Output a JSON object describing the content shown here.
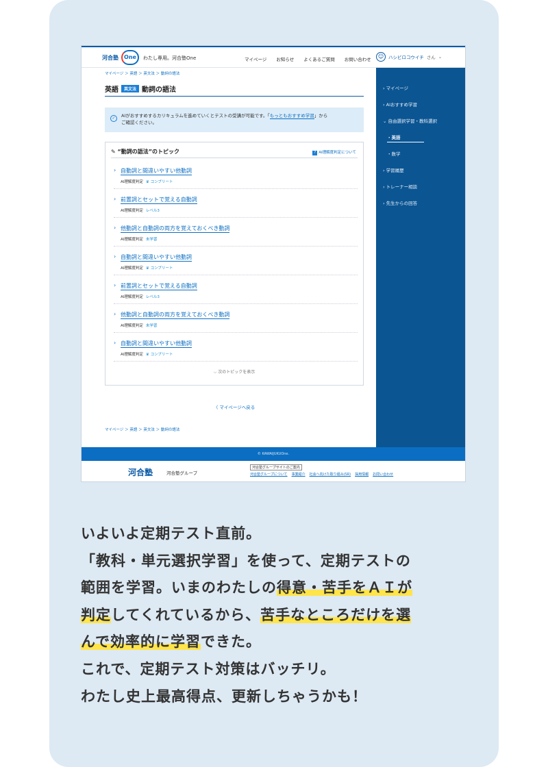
{
  "header": {
    "logo_text": "河合塾",
    "logo_one": "One",
    "logo_sub": "わたし専用。河合塾One",
    "nav": [
      "マイページ",
      "お知らせ",
      "よくあるご質問",
      "お問い合わせ"
    ],
    "user_name": "ハシビロコウイチ",
    "user_suffix": "さん",
    "caret": "⌄"
  },
  "breadcrumb": "マイページ ＞ 英語 ＞ 英文法 ＞ 動詞の語法",
  "page": {
    "subject": "英語",
    "badge": "英文法",
    "title": "動詞の語法"
  },
  "notice": {
    "text1": "AIがおすすめするカリキュラムを進めていくとテストの受講が可能です。「",
    "link": "もっともおすすめ学習",
    "text2": "」から",
    "text3": "ご確認ください。"
  },
  "topics": {
    "title": "“動詞の語法”のトピック",
    "ai_link": "AI理解度判定について",
    "judge_label": "AI理解度判定",
    "items": [
      {
        "name": "自動詞と間違いやすい他動詞",
        "value": "♛ コンプリート"
      },
      {
        "name": "前置詞とセットで覚える自動詞",
        "value": "レベル3"
      },
      {
        "name": "他動詞と自動詞の両方を覚えておくべき動詞",
        "value": "未学習"
      },
      {
        "name": "自動詞と間違いやすい他動詞",
        "value": "♛ コンプリート"
      },
      {
        "name": "前置詞とセットで覚える自動詞",
        "value": "レベル3"
      },
      {
        "name": "他動詞と自動詞の両方を覚えておくべき動詞",
        "value": "未学習"
      },
      {
        "name": "自動詞と間違いやすい他動詞",
        "value": "♛ コンプリート"
      }
    ],
    "more": "⌵ 次のトピックを表示"
  },
  "back": "〈 マイページへ戻る",
  "sidebar": {
    "items": [
      "› マイページ",
      "› AIおすすめ学習",
      "⌄ 自由選択学習・教科選択"
    ],
    "subs": [
      "・英語",
      "・数学"
    ],
    "items2": [
      "› 学習履歴",
      "› トレーナー相談",
      "› 先生からの回答"
    ]
  },
  "footer": {
    "copyright": "© KAWAIJUKUOne.",
    "logo": "河合塾",
    "group": "河合塾グループ",
    "box": "河合塾グループサイトのご案内",
    "links": [
      "河合塾グループについて",
      "事業紹介",
      "社会へ向けた取り組み(SR)",
      "採用情報",
      "お問い合わせ"
    ]
  },
  "body_text": {
    "l1": "いよいよ定期テスト直前。",
    "l2": "「教科・単元選択学習」を使って、定期テストの",
    "l3a": "範囲を学習。いまのわたしの",
    "l3b": "得意・苦手をＡＩが",
    "l4a": "判定",
    "l4b": "してくれているから、",
    "l4c": "苦手なところだけを選",
    "l5a": "んで効率的に学習",
    "l5b": "できた。",
    "l6": "これで、定期テスト対策はバッチリ。",
    "l7": "わたし史上最高得点、更新しちゃうかも！"
  },
  "colors": {
    "accent": "#0b5aa6",
    "sidebar": "#0b5593",
    "highlight": "#ffe44a",
    "card": "#dde9f3"
  }
}
